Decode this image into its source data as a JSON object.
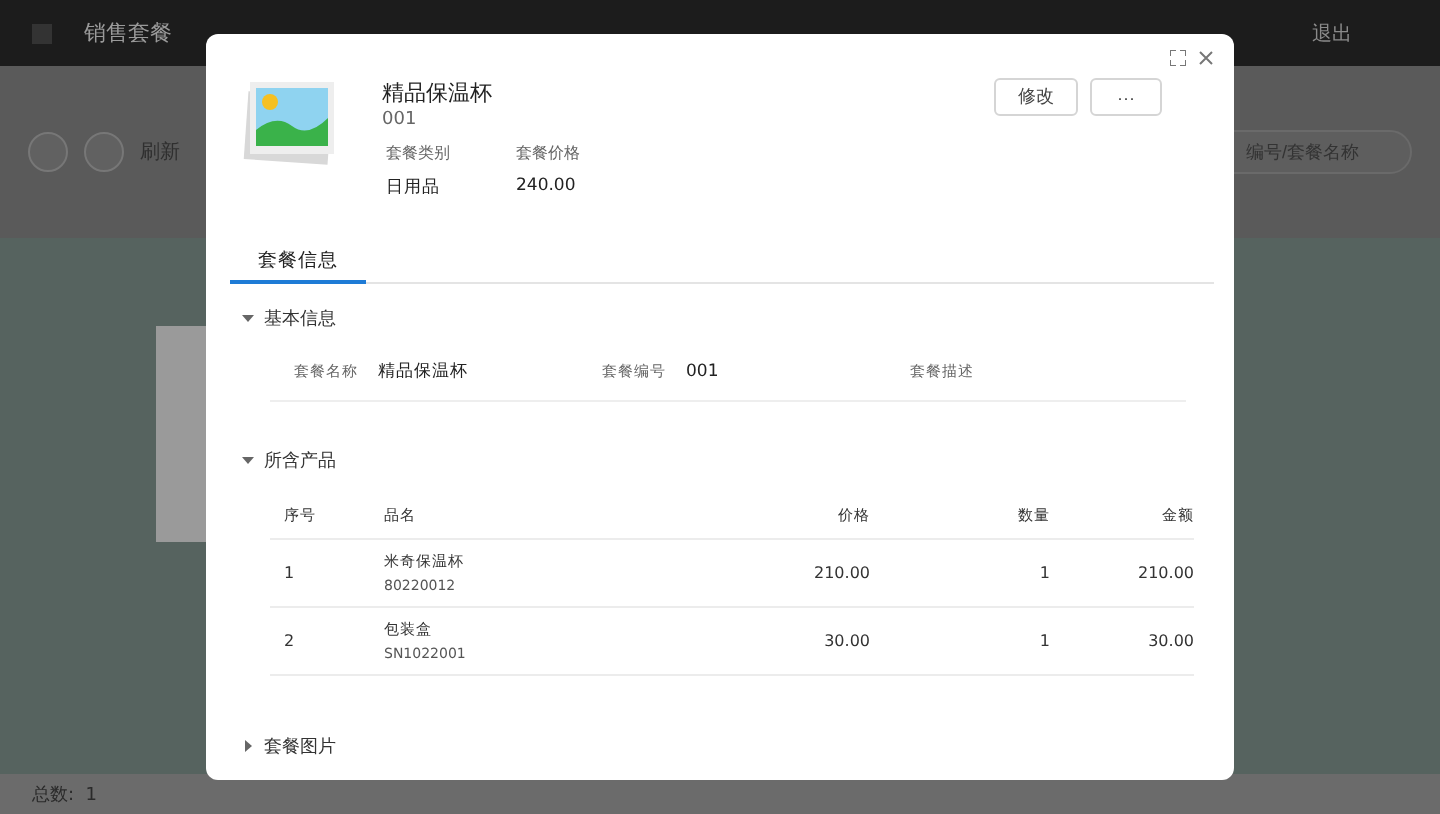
{
  "app": {
    "title": "销售套餐",
    "logout": "退出",
    "refresh": "刷新",
    "search": {
      "placeholder": "编号/套餐名称"
    },
    "total": "总数:  1"
  },
  "modal": {
    "name": "精品保温杯",
    "code": "001",
    "meta": [
      {
        "label": "套餐类别",
        "value": "日用品"
      },
      {
        "label": "套餐价格",
        "value": "240.00"
      }
    ],
    "buttons": [
      {
        "kind": "text",
        "label": "修改"
      },
      {
        "kind": "more",
        "label": "···"
      }
    ],
    "tabs": [
      {
        "label": "套餐信息",
        "selected": true
      }
    ],
    "sections": [
      {
        "title": "基本信息",
        "expanded": true,
        "kind": "fields",
        "fields": [
          {
            "label": "套餐名称",
            "value": "精品保温杯"
          },
          {
            "label": "套餐编号",
            "value": "001"
          },
          {
            "label": "套餐描述"
          }
        ]
      },
      {
        "title": "所含产品",
        "expanded": true,
        "kind": "table",
        "columns": [
          "序号",
          "品名",
          "价格",
          "数量",
          "金额"
        ],
        "rows": [
          {
            "no": "1",
            "name": "米奇保温杯",
            "sku": "80220012",
            "price": "210.00",
            "qty": "1",
            "amount": "210.00"
          },
          {
            "no": "2",
            "name": "包装盒",
            "sku": "SN1022001",
            "price": "30.00",
            "qty": "1",
            "amount": "30.00"
          }
        ]
      },
      {
        "title": "套餐图片",
        "expanded": false,
        "kind": "images"
      }
    ]
  }
}
